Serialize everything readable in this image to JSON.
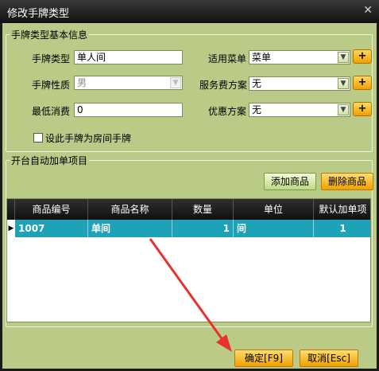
{
  "window": {
    "title": "修改手牌类型",
    "close_icon": "✕"
  },
  "basic_info": {
    "legend": "手牌类型基本信息",
    "type_label": "手牌类型",
    "type_value": "单人间",
    "gender_label": "手牌性质",
    "gender_value": "男",
    "min_spend_label": "最低消费",
    "min_spend_value": "0",
    "menu_label": "适用菜单",
    "menu_value": "菜单",
    "service_label": "服务费方案",
    "service_value": "无",
    "discount_label": "优惠方案",
    "discount_value": "无",
    "plus_label": "+",
    "room_checkbox_label": "设此手牌为房间手牌",
    "room_checkbox_checked": false
  },
  "auto_items": {
    "legend": "开台自动加单项目",
    "add_button": "添加商品",
    "delete_button": "删除商品",
    "columns": [
      "商品编号",
      "商品名称",
      "数量",
      "单位",
      "默认加单项"
    ],
    "rows": [
      {
        "code": "1007",
        "name": "单间",
        "qty": "1",
        "unit": "间",
        "default": "1"
      }
    ]
  },
  "footer": {
    "ok_button": "确定[F9]",
    "cancel_button": "取消[Esc]"
  },
  "colors": {
    "panel_bg": "#b9cb87",
    "row_highlight": "#1ea2b8",
    "accent_orange": "#f0a000",
    "annotation_arrow": "#e8312e"
  }
}
